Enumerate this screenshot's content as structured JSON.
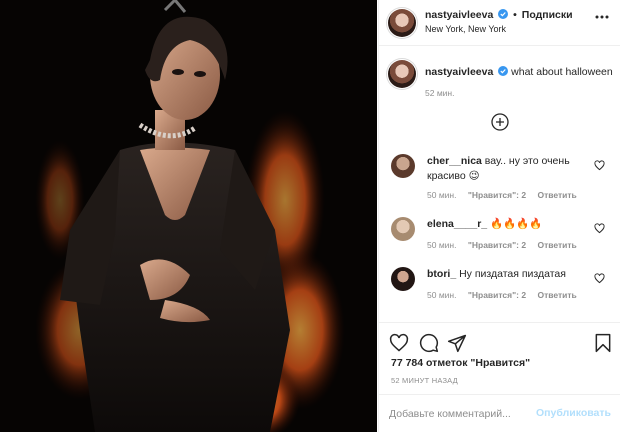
{
  "post": {
    "username": "nastyaivleeva",
    "follow_dot": "•",
    "follow_label": "Подписки",
    "location": "New York, New York",
    "photo_alt": "Woman in black dress with flames",
    "caption_text": "what about halloween",
    "caption_time": "52 мин."
  },
  "comments": [
    {
      "username": "cher__nica",
      "text": "вау.. ну это очень красиво 😉",
      "time": "50 мин.",
      "likes": "\"Нравится\": 2",
      "reply": "Ответить"
    },
    {
      "username": "elena____r_",
      "text": "🔥🔥🔥🔥",
      "time": "50 мин.",
      "likes": "\"Нравится\": 2",
      "reply": "Ответить"
    },
    {
      "username": "btori_",
      "text": "Ну пиздатая пиздатая",
      "time": "50 мин.",
      "likes": "\"Нравится\": 2",
      "reply": "Ответить"
    }
  ],
  "likes_count": "77 784 отметок \"Нравится\"",
  "posted_ago": "52 МИНУТ НАЗАД",
  "comment_input": {
    "placeholder": "Добавьте комментарий..."
  },
  "publish_label": "Опубликовать",
  "icons": {
    "more": "more-options-icon",
    "load_more": "plus-circle-icon",
    "like": "heart-icon",
    "comment": "comment-icon",
    "share": "share-icon",
    "save": "bookmark-icon",
    "verified": "verified-badge-icon"
  },
  "colors": {
    "link": "#0095f6",
    "publish_disabled": "#b2dffc",
    "muted": "#8e8e8e",
    "text": "#262626"
  }
}
